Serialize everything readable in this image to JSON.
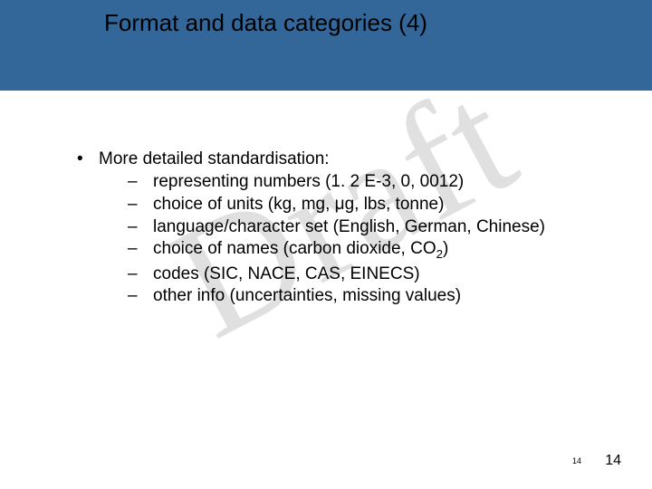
{
  "title": "Format and data categories (4)",
  "watermark": "Draft",
  "main_bullet": "More detailed standardisation:",
  "sub_items": [
    {
      "text": "representing numbers (1. 2 E-3, 0, 0012)"
    },
    {
      "text": "choice of units (kg, mg, μg, lbs, tonne)"
    },
    {
      "text": "language/character set (English, German, Chinese)"
    },
    {
      "html": "choice of names (carbon dioxide, CO<sub>2</sub>)"
    },
    {
      "text": "codes (SIC, NACE, CAS, EINECS)"
    },
    {
      "text": "other info (uncertainties, missing values)"
    }
  ],
  "page_number_small": "14",
  "page_number_large": "14"
}
